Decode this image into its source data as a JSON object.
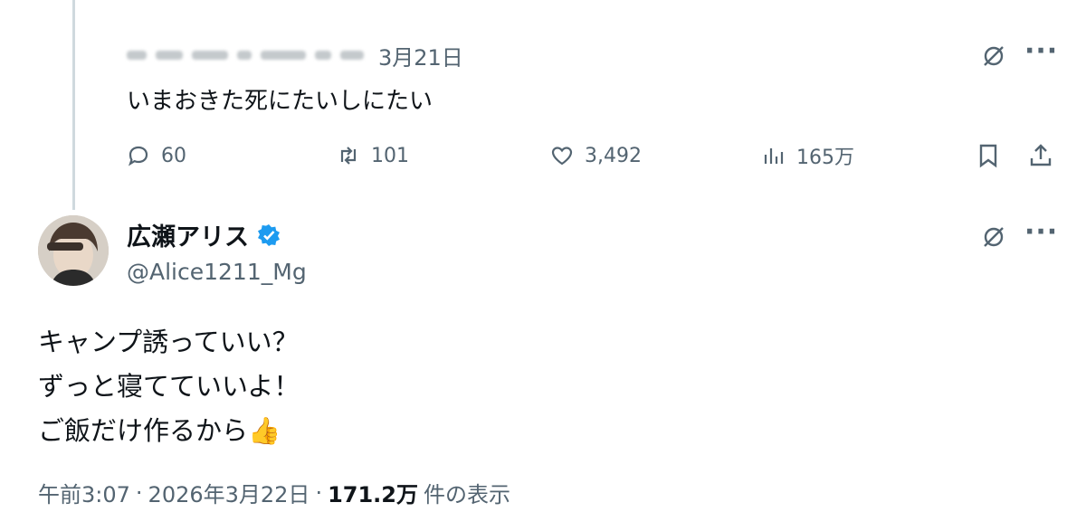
{
  "reply": {
    "date": "3月21日",
    "text": "いまおきた死にたいしにたい",
    "stats": {
      "replies": "60",
      "retweets": "101",
      "likes": "3,492",
      "views": "165万"
    }
  },
  "tweet": {
    "display_name": "広瀬アリス",
    "handle": "@Alice1211_Mg",
    "lines": [
      "キャンプ誘っていい？",
      "ずっと寝てていいよ！",
      "ご飯だけ作るから"
    ],
    "emoji": "👍",
    "footer": {
      "time": "午前3:07",
      "separator": "·",
      "date": "2026年3月22日",
      "views_count": "171.2万",
      "views_label": "件の表示"
    }
  },
  "icons": {
    "grok": "grok-icon",
    "more": "more-icon",
    "reply": "reply-icon",
    "retweet": "retweet-icon",
    "like": "heart-icon",
    "views": "views-icon",
    "bookmark": "bookmark-icon",
    "share": "share-icon",
    "verified": "verified-badge-icon"
  },
  "colors": {
    "text": "#0f1419",
    "secondary": "#536471",
    "verified": "#1d9bf0",
    "thread_line": "#cfd9de"
  }
}
